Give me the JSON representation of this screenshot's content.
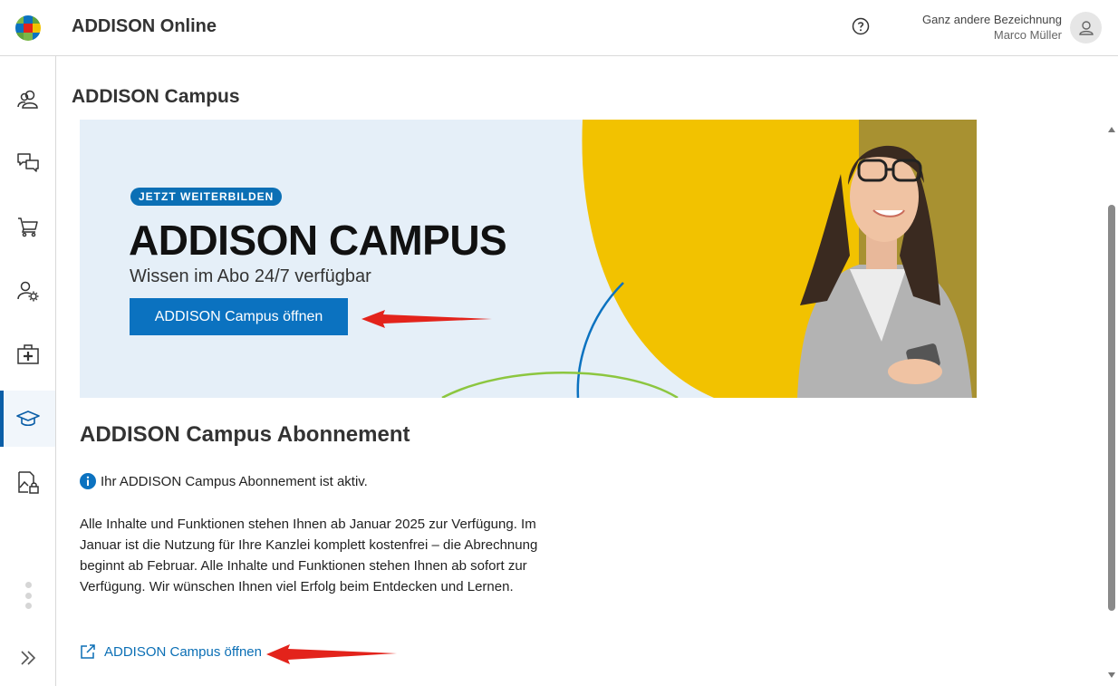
{
  "header": {
    "app_title": "ADDISON Online",
    "user_org": "Ganz andere Bezeichnung",
    "user_name": "Marco Müller",
    "icons": [
      "help-icon",
      "user-avatar-icon"
    ]
  },
  "sidebar": {
    "items": [
      {
        "icon": "users-icon"
      },
      {
        "icon": "chat-icon"
      },
      {
        "icon": "cart-icon"
      },
      {
        "icon": "user-settings-icon"
      },
      {
        "icon": "first-aid-kit-icon"
      },
      {
        "icon": "graduation-cap-icon",
        "active": true
      },
      {
        "icon": "document-lock-icon"
      }
    ],
    "more_icon": "more-vertical-icon",
    "expand_icon": "double-chevron-right-icon"
  },
  "page": {
    "title": "ADDISON Campus"
  },
  "banner": {
    "badge": "JETZT WEITERBILDEN",
    "title": "ADDISON CAMPUS",
    "subtitle": "Wissen im Abo 24/7 verfügbar",
    "button": "ADDISON Campus öffnen"
  },
  "subscription": {
    "title": "ADDISON Campus Abonnement",
    "status": "Ihr ADDISON Campus Abonnement ist aktiv.",
    "body": "Alle Inhalte und Funktionen stehen Ihnen ab Januar 2025 zur Verfügung. Im Januar ist die Nutzung für Ihre Kanzlei komplett kostenfrei – die Abrechnung beginnt ab Februar. Alle Inhalte und Funktionen stehen Ihnen ab sofort zur Verfügung. Wir wünschen Ihnen viel Erfolg beim Entdecken und Lernen.",
    "link": "ADDISON Campus öffnen"
  },
  "colors": {
    "accent": "#0b72c0",
    "banner_bg": "#e5eff8",
    "banner_yellow": "#f2c200",
    "annotation_arrow": "#e3231b"
  }
}
